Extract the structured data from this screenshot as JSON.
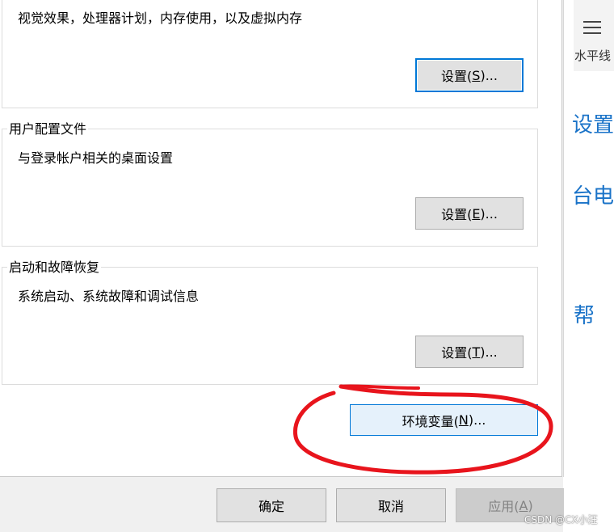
{
  "performance": {
    "description": "视觉效果，处理器计划，内存使用，以及虚拟内存",
    "button_label": "设置(",
    "button_accel": "S",
    "button_suffix": ")..."
  },
  "user_profiles": {
    "title": "用户配置文件",
    "description": "与登录帐户相关的桌面设置",
    "button_label": "设置(",
    "button_accel": "E",
    "button_suffix": ")..."
  },
  "startup_recovery": {
    "title": "启动和故障恢复",
    "description": "系统启动、系统故障和调试信息",
    "button_label": "设置(",
    "button_accel": "T",
    "button_suffix": ")..."
  },
  "env_vars": {
    "label": "环境变量(",
    "accel": "N",
    "suffix": ")..."
  },
  "footer": {
    "ok": "确定",
    "cancel": "取消",
    "apply_label": "应用(",
    "apply_accel": "A",
    "apply_suffix": ")"
  },
  "side_panel": {
    "menu_label": "水平线",
    "links": [
      "设置",
      "台电",
      "帮"
    ]
  },
  "watermark": "CSDN @CX小汪",
  "colors": {
    "accent": "#0078d7",
    "annotation": "#e8141c",
    "link": "#1a73c8"
  }
}
